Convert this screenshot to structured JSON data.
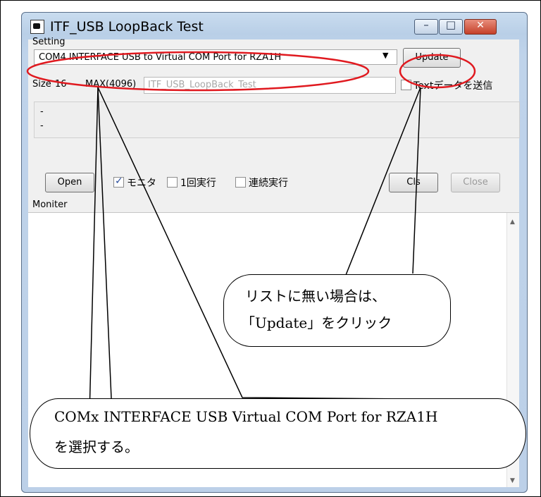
{
  "window": {
    "title": "ITF_USB LoopBack Test",
    "icon": "app-icon",
    "min_icon": "minimize-icon",
    "max_icon": "maximize-icon",
    "close_icon": "close-icon"
  },
  "setting": {
    "label": "Setting",
    "port_value": "COM4  INTERFACE USB to Virtual COM Port for RZA1H",
    "update_label": "Update"
  },
  "size": {
    "label": "Size",
    "value": "16",
    "max_label": "MAX(4096)",
    "text_value": "ITF_USB_LoopBack_Test",
    "send_text_label": "Textデータを送信"
  },
  "status": {
    "line1": "-",
    "line2": "-"
  },
  "controls": {
    "open_label": "Open",
    "monitor_label": "モニタ",
    "once_label": "1回実行",
    "continuous_label": "連続実行",
    "cls_label": "Cls",
    "close_label": "Close"
  },
  "monitor": {
    "label": "Moniter"
  },
  "annotations": {
    "callout_update_line1": "リストに無い場合は、",
    "callout_update_line2": "「Update」をクリック",
    "callout_com_line1": "COMx INTERFACE USB Virtual COM Port for RZA1H",
    "callout_com_line2": "を選択する。",
    "highlight_color": "#e0191f"
  }
}
